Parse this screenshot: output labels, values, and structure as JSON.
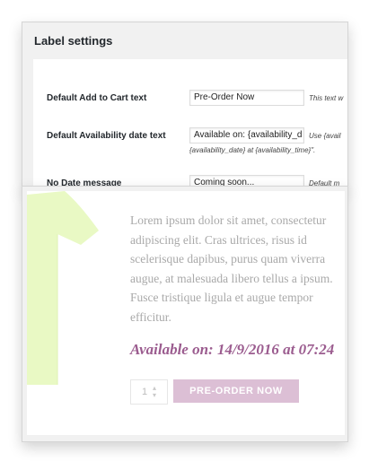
{
  "label_settings": {
    "title": "Label settings",
    "rows": [
      {
        "label": "Default Add to Cart text",
        "value": "Pre-Order Now",
        "hint": "This text w"
      },
      {
        "label": "Default Availability date text",
        "value": "Available on: {availability_d",
        "hint": "Use {avail",
        "hint_line2": "{availability_date} at {availability_time}\"."
      },
      {
        "label": "No Date message",
        "value": "Coming soon...",
        "hint": "Default m"
      }
    ]
  },
  "product": {
    "description_lines": [
      "Lorem ipsum dolor sit amet, consectetur",
      "adipiscing elit. Cras ultrices, risus id",
      "scelerisque dapibus, purus quam viverra",
      "augue, at malesuada libero tellus a ipsum.",
      "Fusce tristique ligula et augue tempor",
      "efficitur."
    ],
    "availability": "Available on: 14/9/2016 at 07:24",
    "quantity": "1",
    "preorder_button": "PRE-ORDER NOW",
    "accent_color": "#9b5c8f",
    "button_color": "#dcbfd5",
    "shirt_color": "#e9f9c4"
  }
}
